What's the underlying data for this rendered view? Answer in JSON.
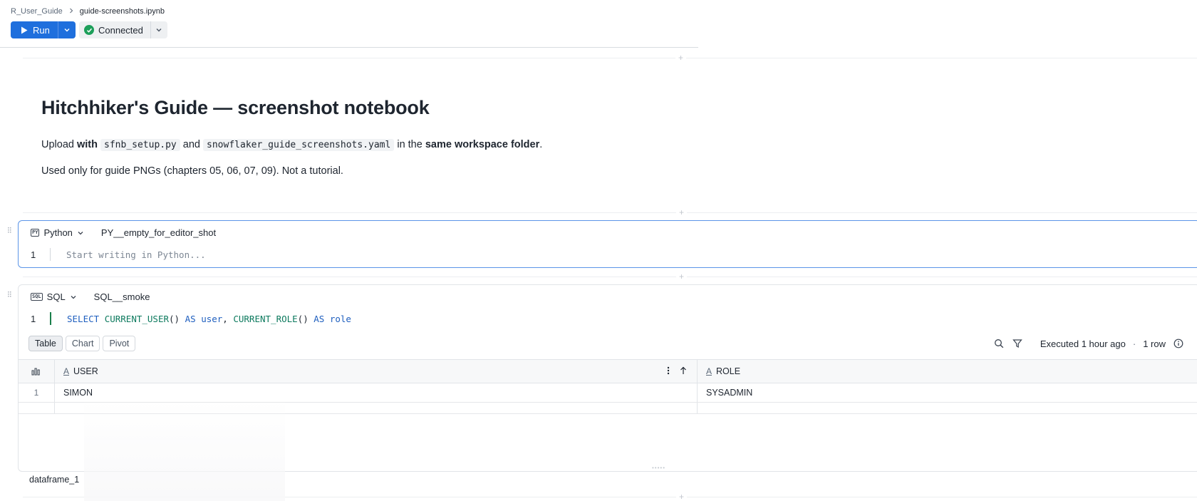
{
  "breadcrumb": {
    "parent": "R_User_Guide",
    "current": "guide-screenshots.ipynb"
  },
  "toolbar": {
    "run_label": "Run",
    "connection_label": "Connected"
  },
  "colors": {
    "accent": "#1f6fdd",
    "connected": "#1d9f5a",
    "selected_cell_border": "#5b95e8"
  },
  "markdown_cell": {
    "title": "Hitchhiker's Guide — screenshot notebook",
    "p1_pre": "Upload",
    "p1_with": "with",
    "p1_code1": "sfnb_setup.py",
    "p1_and": "and",
    "p1_code2": "snowflaker_guide_screenshots.yaml",
    "p1_in": "in the",
    "p1_bold": "same workspace folder",
    "p1_end": ".",
    "p2": "Used only for guide PNGs (chapters 05, 06, 07, 09). Not a tutorial."
  },
  "python_cell": {
    "lang_icon": "PY",
    "language": "Python",
    "name": "PY__empty_for_editor_shot",
    "line_number": "1",
    "placeholder": "Start writing in Python..."
  },
  "sql_cell": {
    "lang_icon": "SQL",
    "language": "SQL",
    "name": "SQL__smoke",
    "line_number": "1",
    "code": {
      "t1": "SELECT",
      "t2": "CURRENT_USER",
      "t3": "()",
      "t4": "AS",
      "t5": "user",
      "t6": ",",
      "t7": "CURRENT_ROLE",
      "t8": "()",
      "t9": "AS",
      "t10": "role"
    },
    "view_tabs": [
      "Table",
      "Chart",
      "Pivot"
    ],
    "executed": "Executed 1 hour ago",
    "dot": "·",
    "row_count": "1 row",
    "columns": [
      {
        "type": "A",
        "name": "USER"
      },
      {
        "type": "A",
        "name": "ROLE"
      }
    ],
    "rows": [
      {
        "index": "1",
        "user": "SIMON",
        "role": "SYSADMIN"
      }
    ],
    "result_name": "dataframe_1"
  }
}
